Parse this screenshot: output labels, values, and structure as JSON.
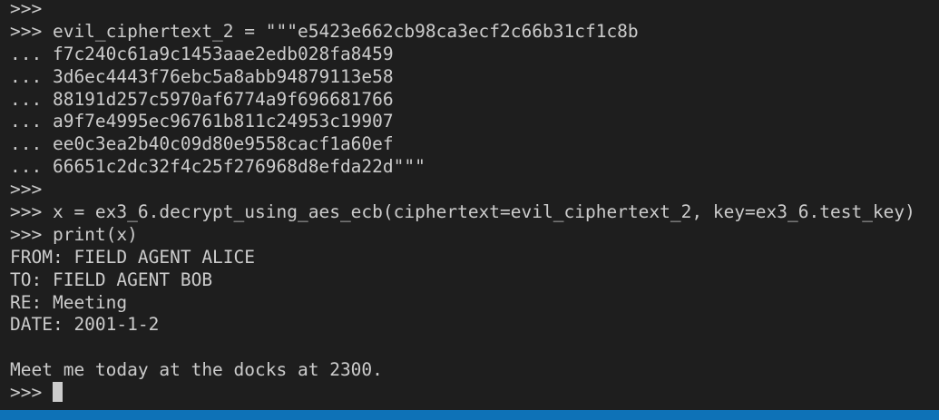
{
  "terminal": {
    "lines": [
      ">>>",
      ">>> evil_ciphertext_2 = \"\"\"e5423e662cb98ca3ecf2c66b31cf1c8b",
      "... f7c240c61a9c1453aae2edb028fa8459",
      "... 3d6ec4443f76ebc5a8abb94879113e58",
      "... 88191d257c5970af6774a9f696681766",
      "... a9f7e4995ec96761b811c24953c19907",
      "... ee0c3ea2b40c09d80e9558cacf1a60ef",
      "... 66651c2dc32f4c25f276968d8efda22d\"\"\"",
      ">>>",
      ">>> x = ex3_6.decrypt_using_aes_ecb(ciphertext=evil_ciphertext_2, key=ex3_6.test_key)",
      ">>> print(x)",
      "FROM: FIELD AGENT ALICE",
      "TO: FIELD AGENT BOB",
      "RE: Meeting",
      "DATE: 2001-1-2",
      "",
      "Meet me today at the docks at 2300."
    ],
    "prompt": ">>> "
  },
  "colors": {
    "background": "#1e1e1e",
    "text": "#cccccc",
    "statusbar": "#0e72b7"
  }
}
